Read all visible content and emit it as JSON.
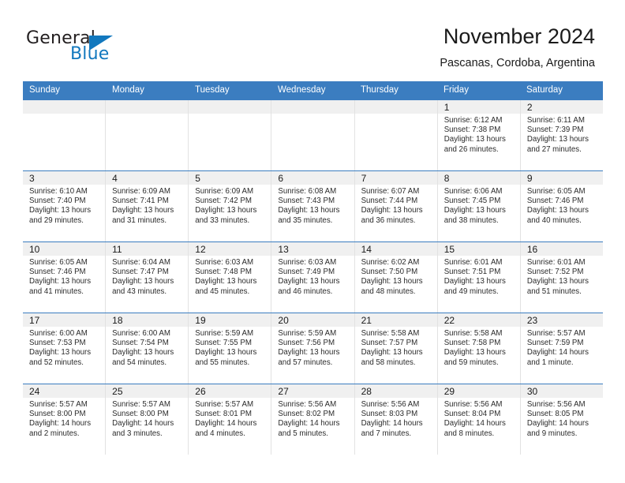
{
  "brand": {
    "name_part1": "General",
    "name_part2": "Blue",
    "accent_color": "#1278be"
  },
  "header": {
    "title": "November 2024",
    "location": "Pascanas, Cordoba, Argentina"
  },
  "theme": {
    "header_row_color": "#3b7dc0",
    "daynum_band_color": "#f0f0f0",
    "grid_line_color": "#e2e2e2"
  },
  "weekdays": [
    "Sunday",
    "Monday",
    "Tuesday",
    "Wednesday",
    "Thursday",
    "Friday",
    "Saturday"
  ],
  "weeks": [
    [
      {
        "day": "",
        "sunrise": "",
        "sunset": "",
        "daylight": "",
        "empty": true
      },
      {
        "day": "",
        "sunrise": "",
        "sunset": "",
        "daylight": "",
        "empty": true
      },
      {
        "day": "",
        "sunrise": "",
        "sunset": "",
        "daylight": "",
        "empty": true
      },
      {
        "day": "",
        "sunrise": "",
        "sunset": "",
        "daylight": "",
        "empty": true
      },
      {
        "day": "",
        "sunrise": "",
        "sunset": "",
        "daylight": "",
        "empty": true
      },
      {
        "day": "1",
        "sunrise": "Sunrise: 6:12 AM",
        "sunset": "Sunset: 7:38 PM",
        "daylight": "Daylight: 13 hours and 26 minutes.",
        "empty": false
      },
      {
        "day": "2",
        "sunrise": "Sunrise: 6:11 AM",
        "sunset": "Sunset: 7:39 PM",
        "daylight": "Daylight: 13 hours and 27 minutes.",
        "empty": false
      }
    ],
    [
      {
        "day": "3",
        "sunrise": "Sunrise: 6:10 AM",
        "sunset": "Sunset: 7:40 PM",
        "daylight": "Daylight: 13 hours and 29 minutes.",
        "empty": false
      },
      {
        "day": "4",
        "sunrise": "Sunrise: 6:09 AM",
        "sunset": "Sunset: 7:41 PM",
        "daylight": "Daylight: 13 hours and 31 minutes.",
        "empty": false
      },
      {
        "day": "5",
        "sunrise": "Sunrise: 6:09 AM",
        "sunset": "Sunset: 7:42 PM",
        "daylight": "Daylight: 13 hours and 33 minutes.",
        "empty": false
      },
      {
        "day": "6",
        "sunrise": "Sunrise: 6:08 AM",
        "sunset": "Sunset: 7:43 PM",
        "daylight": "Daylight: 13 hours and 35 minutes.",
        "empty": false
      },
      {
        "day": "7",
        "sunrise": "Sunrise: 6:07 AM",
        "sunset": "Sunset: 7:44 PM",
        "daylight": "Daylight: 13 hours and 36 minutes.",
        "empty": false
      },
      {
        "day": "8",
        "sunrise": "Sunrise: 6:06 AM",
        "sunset": "Sunset: 7:45 PM",
        "daylight": "Daylight: 13 hours and 38 minutes.",
        "empty": false
      },
      {
        "day": "9",
        "sunrise": "Sunrise: 6:05 AM",
        "sunset": "Sunset: 7:46 PM",
        "daylight": "Daylight: 13 hours and 40 minutes.",
        "empty": false
      }
    ],
    [
      {
        "day": "10",
        "sunrise": "Sunrise: 6:05 AM",
        "sunset": "Sunset: 7:46 PM",
        "daylight": "Daylight: 13 hours and 41 minutes.",
        "empty": false
      },
      {
        "day": "11",
        "sunrise": "Sunrise: 6:04 AM",
        "sunset": "Sunset: 7:47 PM",
        "daylight": "Daylight: 13 hours and 43 minutes.",
        "empty": false
      },
      {
        "day": "12",
        "sunrise": "Sunrise: 6:03 AM",
        "sunset": "Sunset: 7:48 PM",
        "daylight": "Daylight: 13 hours and 45 minutes.",
        "empty": false
      },
      {
        "day": "13",
        "sunrise": "Sunrise: 6:03 AM",
        "sunset": "Sunset: 7:49 PM",
        "daylight": "Daylight: 13 hours and 46 minutes.",
        "empty": false
      },
      {
        "day": "14",
        "sunrise": "Sunrise: 6:02 AM",
        "sunset": "Sunset: 7:50 PM",
        "daylight": "Daylight: 13 hours and 48 minutes.",
        "empty": false
      },
      {
        "day": "15",
        "sunrise": "Sunrise: 6:01 AM",
        "sunset": "Sunset: 7:51 PM",
        "daylight": "Daylight: 13 hours and 49 minutes.",
        "empty": false
      },
      {
        "day": "16",
        "sunrise": "Sunrise: 6:01 AM",
        "sunset": "Sunset: 7:52 PM",
        "daylight": "Daylight: 13 hours and 51 minutes.",
        "empty": false
      }
    ],
    [
      {
        "day": "17",
        "sunrise": "Sunrise: 6:00 AM",
        "sunset": "Sunset: 7:53 PM",
        "daylight": "Daylight: 13 hours and 52 minutes.",
        "empty": false
      },
      {
        "day": "18",
        "sunrise": "Sunrise: 6:00 AM",
        "sunset": "Sunset: 7:54 PM",
        "daylight": "Daylight: 13 hours and 54 minutes.",
        "empty": false
      },
      {
        "day": "19",
        "sunrise": "Sunrise: 5:59 AM",
        "sunset": "Sunset: 7:55 PM",
        "daylight": "Daylight: 13 hours and 55 minutes.",
        "empty": false
      },
      {
        "day": "20",
        "sunrise": "Sunrise: 5:59 AM",
        "sunset": "Sunset: 7:56 PM",
        "daylight": "Daylight: 13 hours and 57 minutes.",
        "empty": false
      },
      {
        "day": "21",
        "sunrise": "Sunrise: 5:58 AM",
        "sunset": "Sunset: 7:57 PM",
        "daylight": "Daylight: 13 hours and 58 minutes.",
        "empty": false
      },
      {
        "day": "22",
        "sunrise": "Sunrise: 5:58 AM",
        "sunset": "Sunset: 7:58 PM",
        "daylight": "Daylight: 13 hours and 59 minutes.",
        "empty": false
      },
      {
        "day": "23",
        "sunrise": "Sunrise: 5:57 AM",
        "sunset": "Sunset: 7:59 PM",
        "daylight": "Daylight: 14 hours and 1 minute.",
        "empty": false
      }
    ],
    [
      {
        "day": "24",
        "sunrise": "Sunrise: 5:57 AM",
        "sunset": "Sunset: 8:00 PM",
        "daylight": "Daylight: 14 hours and 2 minutes.",
        "empty": false
      },
      {
        "day": "25",
        "sunrise": "Sunrise: 5:57 AM",
        "sunset": "Sunset: 8:00 PM",
        "daylight": "Daylight: 14 hours and 3 minutes.",
        "empty": false
      },
      {
        "day": "26",
        "sunrise": "Sunrise: 5:57 AM",
        "sunset": "Sunset: 8:01 PM",
        "daylight": "Daylight: 14 hours and 4 minutes.",
        "empty": false
      },
      {
        "day": "27",
        "sunrise": "Sunrise: 5:56 AM",
        "sunset": "Sunset: 8:02 PM",
        "daylight": "Daylight: 14 hours and 5 minutes.",
        "empty": false
      },
      {
        "day": "28",
        "sunrise": "Sunrise: 5:56 AM",
        "sunset": "Sunset: 8:03 PM",
        "daylight": "Daylight: 14 hours and 7 minutes.",
        "empty": false
      },
      {
        "day": "29",
        "sunrise": "Sunrise: 5:56 AM",
        "sunset": "Sunset: 8:04 PM",
        "daylight": "Daylight: 14 hours and 8 minutes.",
        "empty": false
      },
      {
        "day": "30",
        "sunrise": "Sunrise: 5:56 AM",
        "sunset": "Sunset: 8:05 PM",
        "daylight": "Daylight: 14 hours and 9 minutes.",
        "empty": false
      }
    ]
  ]
}
